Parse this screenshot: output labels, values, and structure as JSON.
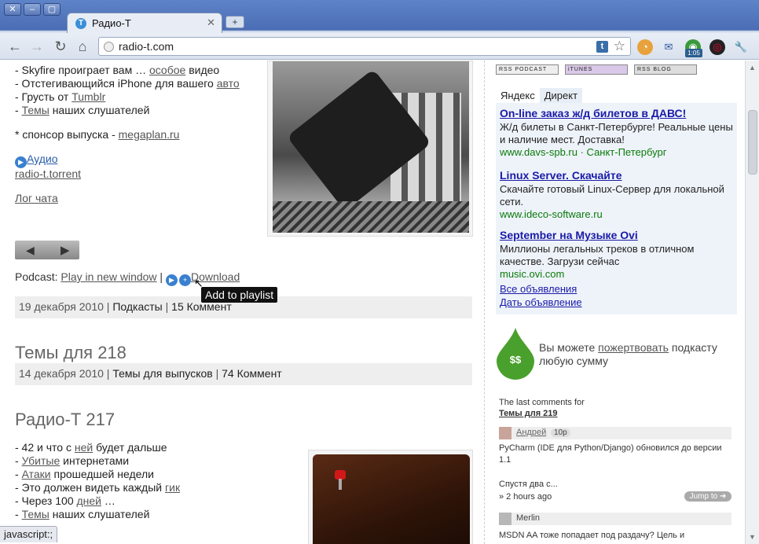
{
  "browser": {
    "tab_title": "Радио-Т",
    "tab_favicon_letter": "T",
    "url": "radio-t.com",
    "clock_badge": "1:05",
    "status_text": "javascript:;"
  },
  "post1": {
    "lines": [
      {
        "prefix": "- Skyfire проиграет вам … ",
        "link": "особое",
        "suffix": " видео"
      },
      {
        "prefix": "- Отстегивающийся iPhone для вашего ",
        "link": "авто",
        "suffix": ""
      },
      {
        "prefix": "- Грусть от ",
        "link": "Tumblr",
        "suffix": ""
      },
      {
        "prefix": "- ",
        "link": "Темы",
        "suffix": " наших слушателей"
      }
    ],
    "sponsor_prefix": "* спонсор выпуска - ",
    "sponsor_link": "megaplan.ru",
    "audio_link": "Аудио",
    "torrent_link": "radio-t.torrent",
    "chat_log_link": "Лог чата",
    "podcast_label": "Podcast: ",
    "play_new_window": "Play in new window",
    "separator": " | ",
    "download": "Download",
    "tooltip": "Add to playlist",
    "meta_date": "19 декабря 2010 | ",
    "meta_cat": "Подкасты",
    "meta_sep": " | ",
    "meta_comments": "15 Коммент"
  },
  "post2": {
    "title": "Темы для 218",
    "meta_date": "14 декабря 2010 | ",
    "meta_cat": "Темы для выпусков",
    "meta_sep": " | ",
    "meta_comments": "74 Коммент"
  },
  "post3": {
    "title": "Радио-Т 217",
    "lines": [
      {
        "prefix": "- 42 и что с ",
        "link": "ней",
        "suffix": " будет дальше"
      },
      {
        "prefix": "- ",
        "link": "Убитые",
        "suffix": " интернетами"
      },
      {
        "prefix": "- ",
        "link": "Атаки",
        "suffix": " прошедшей недели"
      },
      {
        "prefix": "- Это должен видеть каждый ",
        "link": "гик",
        "suffix": ""
      },
      {
        "prefix": "- Через 100 ",
        "link": "дней",
        "suffix": " …"
      },
      {
        "prefix": "- ",
        "link": "Темы",
        "suffix": " наших слушателей"
      }
    ]
  },
  "sidebar": {
    "feed_buttons": [
      "RSS PODCAST",
      "iTUNES",
      "RSS BLOG"
    ],
    "ad_tabs": [
      "Яндекс",
      "Директ"
    ],
    "ads": [
      {
        "title": "On-line заказ ж/д билетов в ДАВС!",
        "desc": "Ж/д билеты в Санкт-Петербурге! Реальные цены и наличие мест. Доставка!",
        "url": "www.davs-spb.ru  ·  Санкт-Петербург"
      },
      {
        "title": "Linux Server. Скачайте",
        "desc": "Скачайте готовый Linux-Сервер для локальной сети.",
        "url": "www.ideco-software.ru"
      },
      {
        "title": "September на Музыке Ovi",
        "desc": "Миллионы легальных треков в отличном качестве. Загрузи сейчас",
        "url": "music.ovi.com"
      }
    ],
    "all_ads": "Все объявления",
    "give_ad": "Дать объявление",
    "donate_symbol": "$$",
    "donate_prefix": "Вы можете ",
    "donate_link": "пожертвовать",
    "donate_suffix": " подкасту любую сумму",
    "last_comments_label": "The last comments for",
    "last_comments_topic": "Темы для 219",
    "comments": [
      {
        "author": "Андрей",
        "points": "10p",
        "text": "PyCharm (IDE для Python/Django) обновился до версии 1.1",
        "text2": "Спустя два с...",
        "time": "» 2 hours ago",
        "jump": "Jump to ➔"
      },
      {
        "author": "Merlin",
        "text": "MSDN AA тоже попадает под раздачу? Цель и"
      }
    ]
  },
  "colors": {
    "ad_title": "#1a1aa8",
    "ad_url": "#0a7a0a",
    "drop_green": "#4aa02c",
    "chrome_blue": "#4a6db4"
  }
}
